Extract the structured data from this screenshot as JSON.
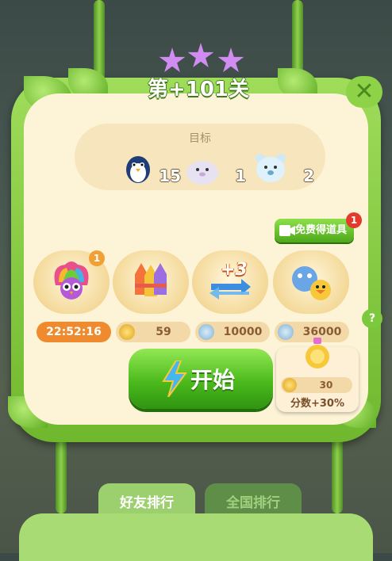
{
  "level": {
    "title": "第+101关",
    "stars": 3
  },
  "close": {
    "label": "✕"
  },
  "goals": {
    "title": "目标",
    "items": [
      {
        "icon": "penguin-icon",
        "count": "15"
      },
      {
        "icon": "seal-icon",
        "count": "1"
      },
      {
        "icon": "polar-bear-icon",
        "count": "2"
      }
    ]
  },
  "free_props": {
    "label": "免费得道具",
    "badge": "1"
  },
  "boosters": [
    {
      "icon": "rainbow-owl-icon",
      "badge": "1",
      "slot_text": "22:52:16"
    },
    {
      "icon": "rocket-bundle-icon",
      "slot_text": "59"
    },
    {
      "icon": "plus-three-moves-icon",
      "label": "+3",
      "slot_text": "10000"
    },
    {
      "icon": "animal-pair-icon",
      "slot_text": "36000"
    }
  ],
  "help": {
    "label": "?"
  },
  "start": {
    "label": "开始"
  },
  "bonus": {
    "cost": "30",
    "label": "分数+30%"
  },
  "tabs": [
    {
      "label": "好友排行"
    },
    {
      "label": "全国排行"
    }
  ]
}
